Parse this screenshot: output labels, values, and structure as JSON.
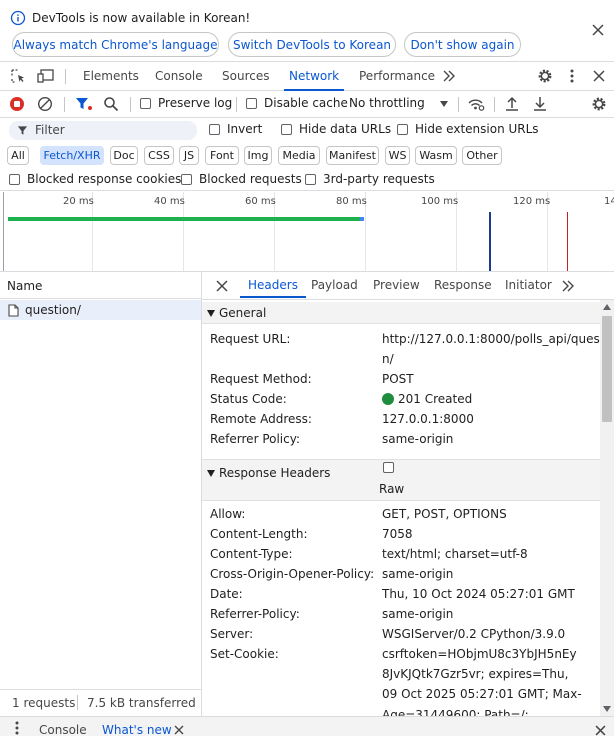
{
  "banner": {
    "message": "DevTools is now available in Korean!",
    "buttons": [
      "Always match Chrome's language",
      "Switch DevTools to Korean",
      "Don't show again"
    ]
  },
  "main_tabs": [
    "Elements",
    "Console",
    "Sources",
    "Network",
    "Performance"
  ],
  "toolbar": {
    "preserve_log": "Preserve log",
    "disable_cache": "Disable cache",
    "throttling": "No throttling"
  },
  "filter": {
    "placeholder": "Filter",
    "invert": "Invert",
    "hide_data_urls": "Hide data URLs",
    "hide_extension_urls": "Hide extension URLs"
  },
  "type_chips": [
    "All",
    "Fetch/XHR",
    "Doc",
    "CSS",
    "JS",
    "Font",
    "Img",
    "Media",
    "Manifest",
    "WS",
    "Wasm",
    "Other"
  ],
  "selected_chip": "Fetch/XHR",
  "blocked": {
    "cookies": "Blocked response cookies",
    "requests": "Blocked requests",
    "third_party": "3rd-party requests"
  },
  "timeline": {
    "ticks": [
      "20 ms",
      "40 ms",
      "60 ms",
      "80 ms",
      "100 ms",
      "120 ms",
      "14"
    ],
    "bar_color": "#1db04e"
  },
  "request_list": {
    "header": "Name",
    "rows": [
      "question/"
    ],
    "status": {
      "requests": "1 requests",
      "transferred": "7.5 kB transferred"
    }
  },
  "detail_tabs": [
    "Headers",
    "Payload",
    "Preview",
    "Response",
    "Initiator"
  ],
  "general": {
    "title": "General",
    "rows": [
      {
        "key": "Request URL:",
        "value": "http://127.0.0.1:8000/polls_api/questio",
        "value2": "n/"
      },
      {
        "key": "Request Method:",
        "value": "POST"
      },
      {
        "key": "Status Code:",
        "value": "201 Created"
      },
      {
        "key": "Remote Address:",
        "value": "127.0.0.1:8000"
      },
      {
        "key": "Referrer Policy:",
        "value": "same-origin"
      }
    ]
  },
  "response_headers": {
    "title": "Response Headers",
    "raw": "Raw",
    "rows": [
      {
        "key": "Allow:",
        "value": "GET, POST, OPTIONS"
      },
      {
        "key": "Content-Length:",
        "value": "7058"
      },
      {
        "key": "Content-Type:",
        "value": "text/html; charset=utf-8"
      },
      {
        "key": "Cross-Origin-Opener-Policy:",
        "value": "same-origin"
      },
      {
        "key": "Date:",
        "value": "Thu, 10 Oct 2024 05:27:01 GMT"
      },
      {
        "key": "Referrer-Policy:",
        "value": "same-origin"
      },
      {
        "key": "Server:",
        "value": "WSGIServer/0.2 CPython/3.9.0"
      },
      {
        "key": "Set-Cookie:",
        "value": "csrftoken=HObjmU8c3YbJH5nEy",
        "value2": "8JvKJQtk7Gzr5vr; expires=Thu,",
        "value3": "09 Oct 2025 05:27:01 GMT; Max-",
        "value4": "Age=31449600; Path=/;"
      }
    ]
  },
  "drawer": {
    "tabs": [
      "Console",
      "What's new"
    ]
  },
  "colors": {
    "accent": "#0b57d0",
    "status_ok": "#1e8e3e",
    "record_red": "#d93025"
  }
}
